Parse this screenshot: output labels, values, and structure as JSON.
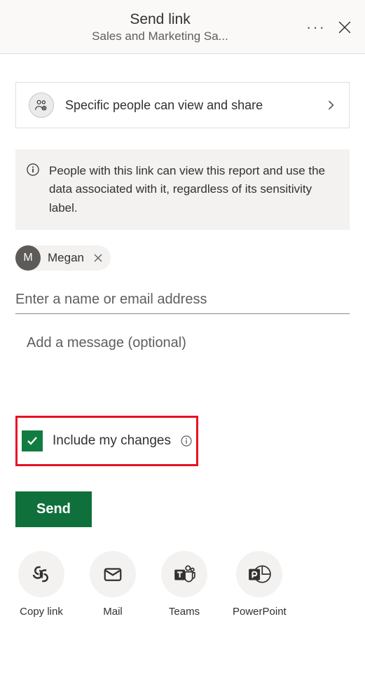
{
  "header": {
    "title": "Send link",
    "subtitle": "Sales and Marketing Sa..."
  },
  "permission": {
    "label": "Specific people can view and share"
  },
  "info": {
    "text": "People with this link can view this report and use the data associated with it, regardless of its sensitivity label."
  },
  "recipient": {
    "initial": "M",
    "name": "Megan"
  },
  "nameInput": {
    "placeholder": "Enter a name or email address"
  },
  "messageInput": {
    "placeholder": "Add a message (optional)"
  },
  "include": {
    "label": "Include my changes"
  },
  "send": {
    "label": "Send"
  },
  "share": {
    "copyLink": "Copy link",
    "mail": "Mail",
    "teams": "Teams",
    "powerpoint": "PowerPoint"
  }
}
